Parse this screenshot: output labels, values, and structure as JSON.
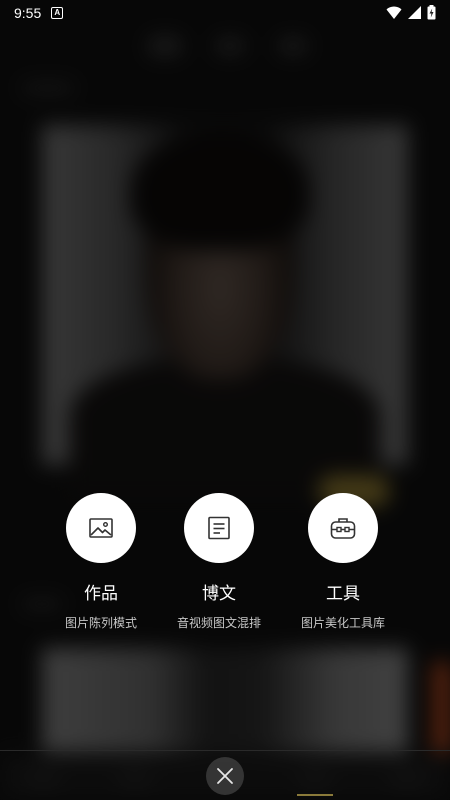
{
  "status_bar": {
    "time": "9:55",
    "notification_icon": "a-box-icon",
    "icons": [
      "wifi-icon",
      "signal-icon",
      "battery-charging-icon"
    ]
  },
  "actions": [
    {
      "title": "作品",
      "subtitle": "图片陈列模式",
      "icon": "image-icon"
    },
    {
      "title": "博文",
      "subtitle": "音视频图文混排",
      "icon": "document-icon"
    },
    {
      "title": "工具",
      "subtitle": "图片美化工具库",
      "icon": "toolbox-icon"
    }
  ],
  "close": {
    "icon": "close-icon"
  },
  "colors": {
    "circle_bg": "#ffffff",
    "icon_stroke": "#333333",
    "title_text": "#ffffff",
    "subtitle_text": "#c8c8c8",
    "overlay": "rgba(0,0,0,0.55)"
  }
}
